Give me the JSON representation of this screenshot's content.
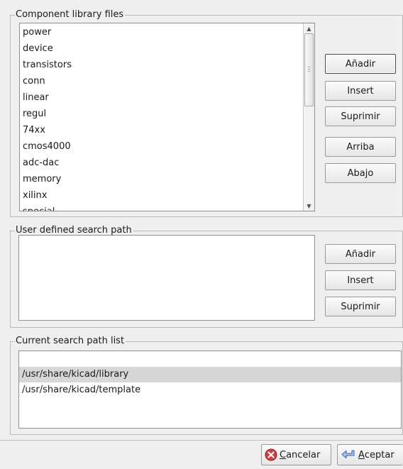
{
  "component_library": {
    "title": "Component library files",
    "items": [
      "power",
      "device",
      "transistors",
      "conn",
      "linear",
      "regul",
      "74xx",
      "cmos4000",
      "adc-dac",
      "memory",
      "xilinx",
      "special"
    ],
    "buttons": {
      "add": "Añadir",
      "insert": "Insert",
      "remove": "Suprimir",
      "up": "Arriba",
      "down": "Abajo"
    }
  },
  "user_search_path": {
    "title": "User defined search path",
    "items": [],
    "buttons": {
      "add": "Añadir",
      "insert": "Insert",
      "remove": "Suprimir"
    }
  },
  "current_search_path": {
    "title": "Current search path list",
    "items": [
      "",
      "/usr/share/kicad/library",
      "/usr/share/kicad/template"
    ],
    "selected_index": 1
  },
  "dialog_buttons": {
    "cancel": {
      "mnemonic": "C",
      "rest": "ancelar",
      "icon": "cancel-icon"
    },
    "ok": {
      "mnemonic": "A",
      "rest": "ceptar",
      "icon": "ok-icon"
    }
  }
}
